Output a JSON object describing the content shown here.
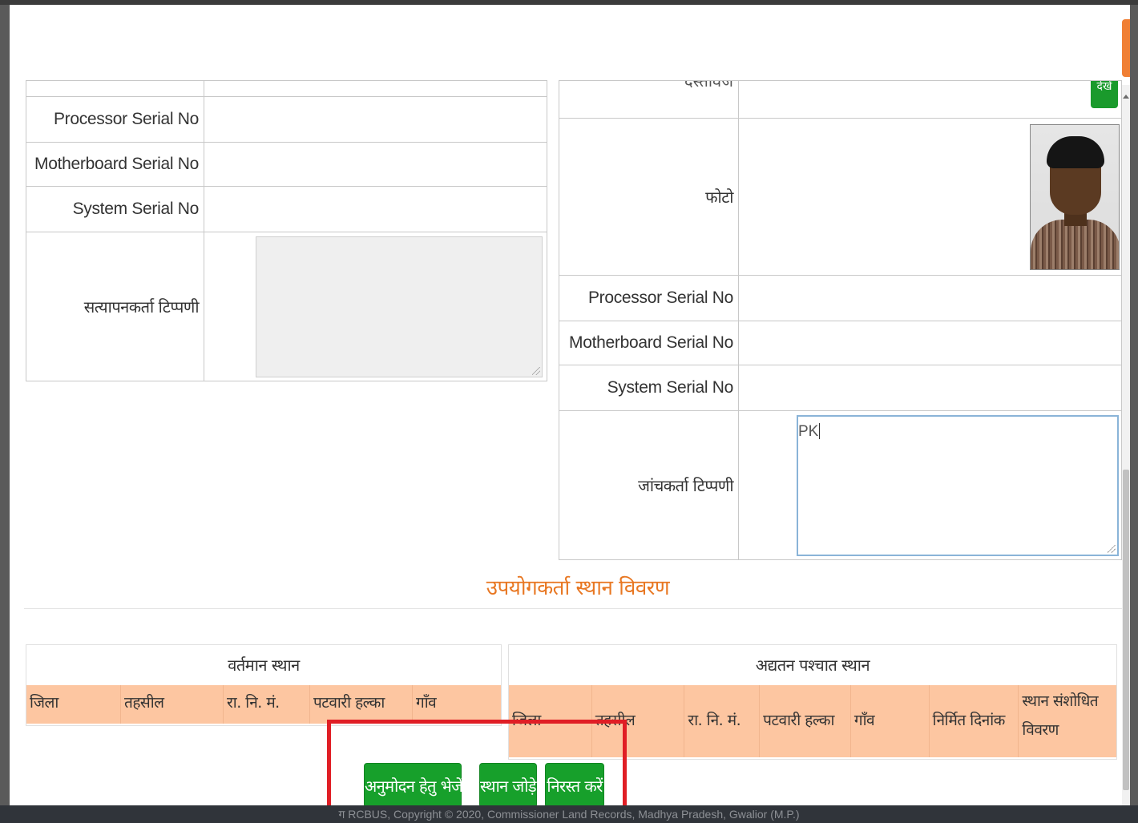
{
  "left_form": {
    "rows": [
      {
        "label": "Processor Serial No",
        "value": ""
      },
      {
        "label": "Motherboard Serial No",
        "value": ""
      },
      {
        "label": "System Serial No",
        "value": ""
      }
    ],
    "remark_label": "सत्यापनकर्ता टिप्पणी",
    "remark_value": ""
  },
  "right_form": {
    "document_label": "दस्तावेज",
    "document_button": "देखें",
    "photo_label": "फोटो",
    "rows": [
      {
        "label": "Processor Serial No",
        "value": ""
      },
      {
        "label": "Motherboard Serial No",
        "value": ""
      },
      {
        "label": "System Serial No",
        "value": ""
      }
    ],
    "remark_label": "जांचकर्ता टिप्पणी",
    "remark_value": "PK"
  },
  "location_section": {
    "title": "उपयोगकर्ता स्थान विवरण",
    "current": {
      "heading": "वर्तमान स्थान",
      "columns": [
        "जिला",
        "तहसील",
        "रा. नि. मं.",
        "पटवारी हल्का",
        "गाँव"
      ]
    },
    "updated": {
      "heading": "अद्यतन पश्चात स्थान",
      "columns": [
        "जिला",
        "तहसील",
        "रा. नि. मं.",
        "पटवारी हल्का",
        "गाँव",
        "निर्मित दिनांक",
        "स्थान संशोधित विवरण"
      ]
    }
  },
  "actions": {
    "send_for_approval": "अनुमोदन हेतु भेजें",
    "add_location": "स्थान जोड़े",
    "cancel": "निरस्त करें"
  },
  "footer_text": "ग RCBUS, Copyright © 2020, Commissioner Land Records, Madhya Pradesh, Gwalior (M.P.)",
  "colors": {
    "accent_orange": "#e87722",
    "header_peach": "#fdc6a1",
    "button_green": "#17a02b",
    "highlight_red": "#e01e25"
  }
}
